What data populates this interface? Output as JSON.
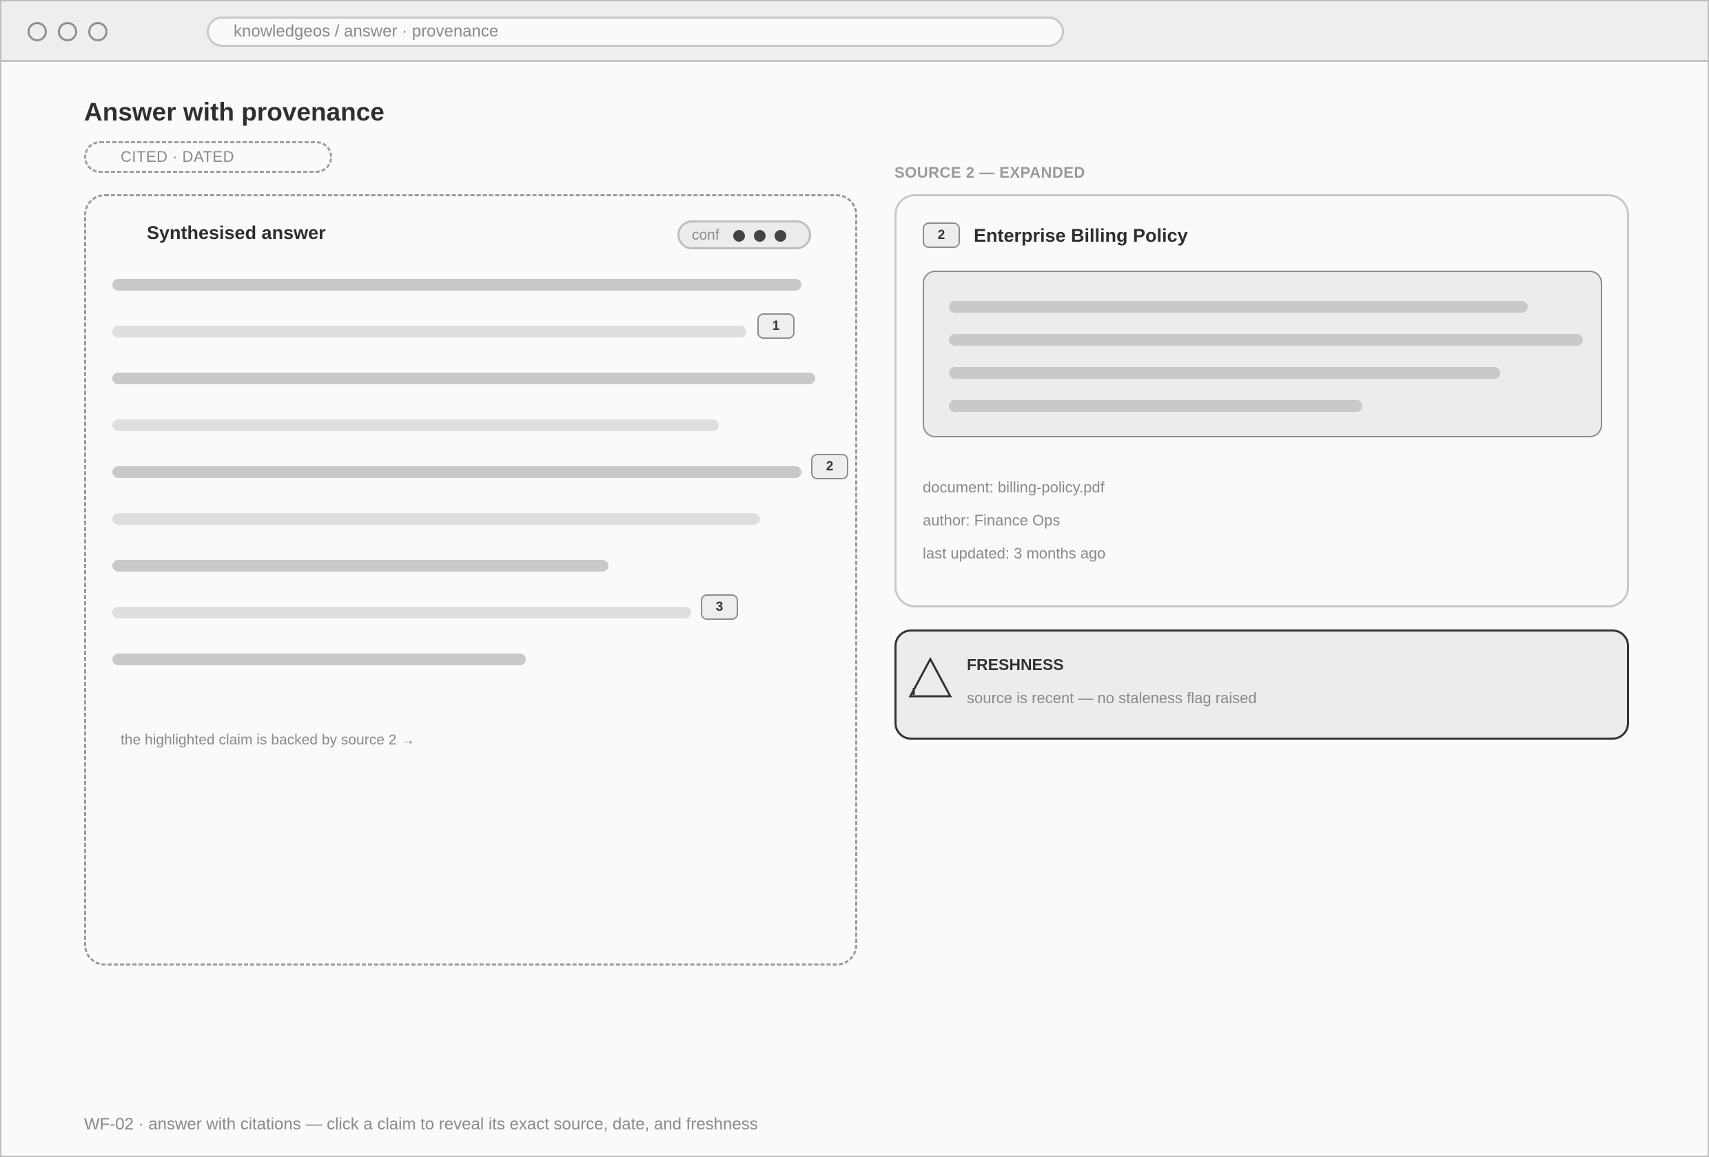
{
  "browser": {
    "address": "knowledgeos / answer · provenance"
  },
  "page": {
    "title": "Answer with provenance",
    "tag": "CITED · DATED"
  },
  "answer": {
    "title": "Synthesised answer",
    "confidence_label": "conf",
    "confidence_level": 3,
    "citations": [
      "1",
      "2",
      "3"
    ],
    "note": "the highlighted claim is backed by source 2 →"
  },
  "source": {
    "heading": "SOURCE 2 — EXPANDED",
    "number": "2",
    "title": "Enterprise Billing Policy",
    "document": "document: billing-policy.pdf",
    "author": "author: Finance Ops",
    "updated": "last updated: 3 months ago"
  },
  "freshness": {
    "icon": "warning-triangle-icon",
    "title": "FRESHNESS",
    "text": "source is recent — no staleness flag raised"
  },
  "footer": {
    "caption": "WF-02 · answer with citations — click a claim to reveal its exact source, date, and freshness"
  }
}
